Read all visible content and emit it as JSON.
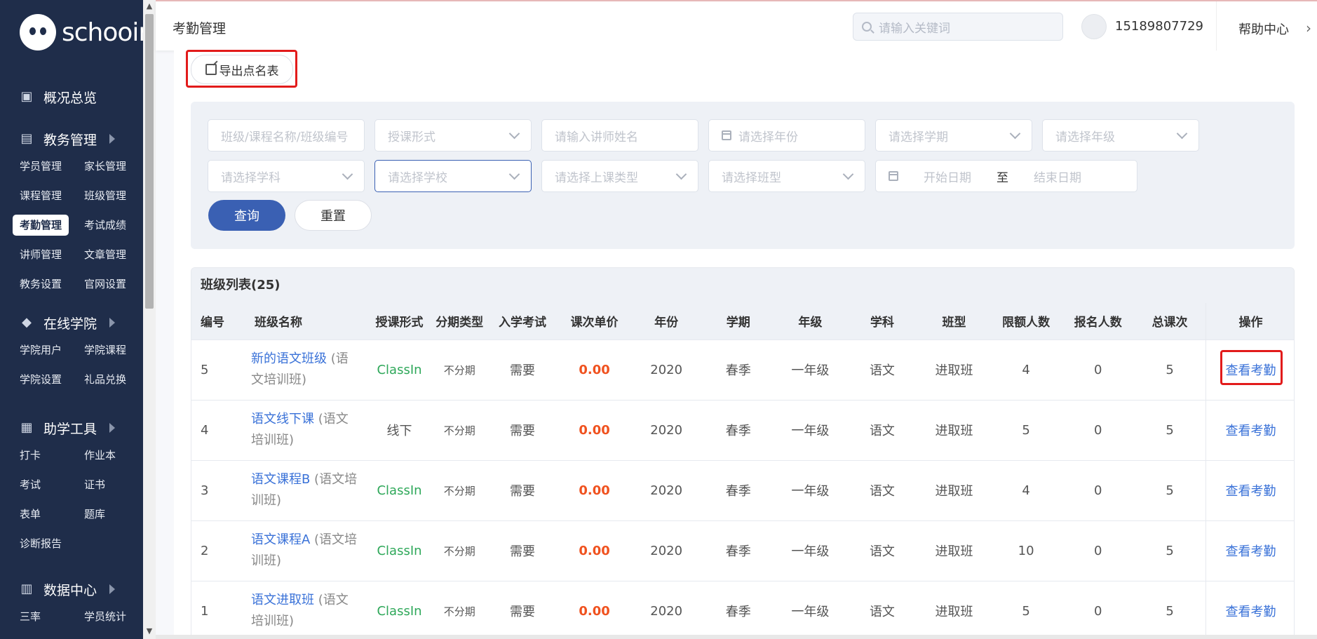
{
  "brand": {
    "name": "schooin"
  },
  "sidebar": {
    "groups": [
      {
        "label": "概况总览",
        "icon": "monitor-icon",
        "arrow": false,
        "items": []
      },
      {
        "label": "教务管理",
        "icon": "book-icon",
        "arrow": true,
        "items": [
          "学员管理",
          "家长管理",
          "课程管理",
          "班级管理",
          "考勤管理",
          "考试成绩",
          "讲师管理",
          "文章管理",
          "教务设置",
          "官网设置"
        ]
      },
      {
        "label": "在线学院",
        "icon": "graduation-cap-icon",
        "arrow": true,
        "items": [
          "学院用户",
          "学院课程",
          "学院设置",
          "礼品兑换"
        ]
      },
      {
        "label": "助学工具",
        "icon": "grid-icon",
        "arrow": true,
        "items": [
          "打卡",
          "作业本",
          "考试",
          "证书",
          "表单",
          "题库",
          "诊断报告"
        ]
      },
      {
        "label": "数据中心",
        "icon": "chart-icon",
        "arrow": true,
        "items": [
          "三率",
          "学员统计"
        ]
      }
    ],
    "active_item": "考勤管理"
  },
  "header": {
    "title": "考勤管理",
    "search_placeholder": "请输入关键词",
    "phone": "15189807729",
    "help": "帮助中心"
  },
  "toolbar": {
    "export_label": "导出点名表"
  },
  "filters": {
    "class_placeholder": "班级/课程名称/班级编号",
    "teach_form": "授课形式",
    "teacher": "请输入讲师姓名",
    "year": "请选择年份",
    "term": "请选择学期",
    "grade": "请选择年级",
    "subject": "请选择学科",
    "school": "请选择学校",
    "lesson_type": "请选择上课类型",
    "class_type": "请选择班型",
    "start_date": "开始日期",
    "to": "至",
    "end_date": "结束日期",
    "query_label": "查询",
    "reset_label": "重置"
  },
  "table": {
    "title": "班级列表(25)",
    "columns": [
      "编号",
      "班级名称",
      "授课形式",
      "分期类型",
      "入学考试",
      "课次单价",
      "年份",
      "学期",
      "年级",
      "学科",
      "班型",
      "限额人数",
      "报名人数",
      "总课次",
      "操作"
    ],
    "rows": [
      {
        "id": "5",
        "name": "新的语文班级",
        "sub": "(语文培训班)",
        "form": "ClassIn",
        "installment": "不分期",
        "exam": "需要",
        "price": "0.00",
        "year": "2020",
        "term": "春季",
        "grade": "一年级",
        "subject": "语文",
        "type": "进取班",
        "limit": "4",
        "enrolled": "0",
        "lessons": "5",
        "op": "查看考勤"
      },
      {
        "id": "4",
        "name": "语文线下课",
        "sub": "(语文培训班)",
        "form": "线下",
        "installment": "不分期",
        "exam": "需要",
        "price": "0.00",
        "year": "2020",
        "term": "春季",
        "grade": "一年级",
        "subject": "语文",
        "type": "进取班",
        "limit": "5",
        "enrolled": "0",
        "lessons": "5",
        "op": "查看考勤"
      },
      {
        "id": "3",
        "name": "语文课程B",
        "sub": "(语文培训班)",
        "form": "ClassIn",
        "installment": "不分期",
        "exam": "需要",
        "price": "0.00",
        "year": "2020",
        "term": "春季",
        "grade": "一年级",
        "subject": "语文",
        "type": "进取班",
        "limit": "4",
        "enrolled": "0",
        "lessons": "5",
        "op": "查看考勤"
      },
      {
        "id": "2",
        "name": "语文课程A",
        "sub": "(语文培训班)",
        "form": "ClassIn",
        "installment": "不分期",
        "exam": "需要",
        "price": "0.00",
        "year": "2020",
        "term": "春季",
        "grade": "一年级",
        "subject": "语文",
        "type": "进取班",
        "limit": "10",
        "enrolled": "0",
        "lessons": "5",
        "op": "查看考勤"
      },
      {
        "id": "1",
        "name": "语文进取班",
        "sub": "(语文培训班)",
        "form": "ClassIn",
        "installment": "不分期",
        "exam": "需要",
        "price": "0.00",
        "year": "2020",
        "term": "春季",
        "grade": "一年级",
        "subject": "语文",
        "type": "进取班",
        "limit": "5",
        "enrolled": "0",
        "lessons": "5",
        "op": "查看考勤"
      }
    ]
  },
  "colors": {
    "sidebar_bg": "#1f2d4a",
    "primary": "#3a60b3",
    "link": "#3a72d8",
    "price": "#f0521f",
    "classin": "#2fa85a",
    "highlight": "#e21b1b"
  }
}
